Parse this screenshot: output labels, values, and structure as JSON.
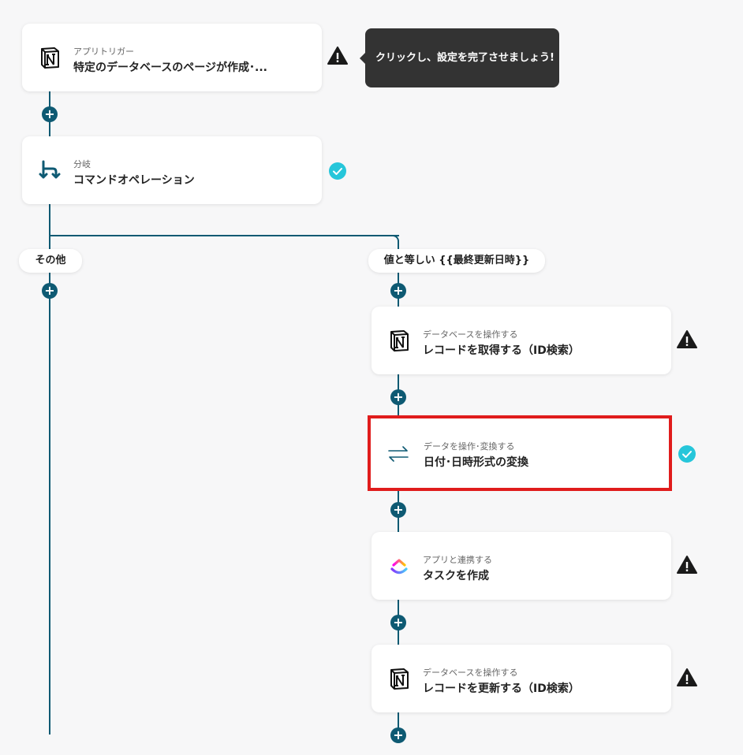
{
  "colors": {
    "connector": "#0e5a73",
    "highlight": "#e01c1c",
    "success": "#26c6da",
    "warning": "#1a1a1a",
    "tooltip_bg": "#333333"
  },
  "tooltip": {
    "text": "クリックし、設定を完了させましょう!"
  },
  "flow": {
    "trigger": {
      "sub": "アプリトリガー",
      "title": "特定のデータベースのページが作成･...",
      "icon": "notion-icon",
      "status": "warning"
    },
    "branch": {
      "sub": "分岐",
      "title": "コマンドオペレーション",
      "icon": "branch-icon",
      "status": "success"
    },
    "branches": {
      "left_label": "その他",
      "right_label": "値と等しい {{最終更新日時}}"
    },
    "steps": [
      {
        "sub": "データベースを操作する",
        "title": "レコードを取得する（ID検索）",
        "icon": "notion-icon",
        "status": "warning"
      },
      {
        "sub": "データを操作･変換する",
        "title": "日付･日時形式の変換",
        "icon": "convert-arrows-icon",
        "status": "success"
      },
      {
        "sub": "アプリと連携する",
        "title": "タスクを作成",
        "icon": "clickup-icon",
        "status": "warning"
      },
      {
        "sub": "データベースを操作する",
        "title": "レコードを更新する（ID検索）",
        "icon": "notion-icon",
        "status": "warning"
      }
    ],
    "add_step_label": "+"
  }
}
